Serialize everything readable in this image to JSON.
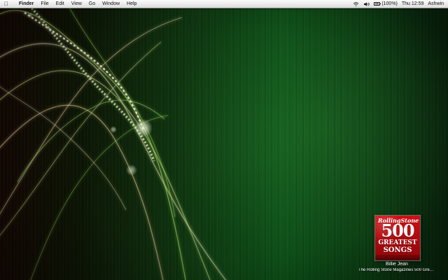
{
  "menubar": {
    "app_name": "Finder",
    "menus": [
      "File",
      "Edit",
      "View",
      "Go",
      "Window",
      "Help"
    ],
    "status": {
      "battery_text": "(100%)",
      "time": "Thu 12:59",
      "user": "Ashwin"
    },
    "icons": {
      "apple": "apple-icon",
      "wifi": "wifi-icon",
      "volume": "volume-icon",
      "battery": "battery-icon"
    }
  },
  "desktop": {
    "wallpaper": {
      "dominant_colors": [
        "#0d5318",
        "#103a11",
        "#150803",
        "#f1f4b8",
        "#b9ff66"
      ]
    },
    "now_playing": {
      "album_art": {
        "logo": "RollingStone",
        "number": "500",
        "title_line_1": "GREATEST",
        "title_line_2": "SONGS"
      },
      "song": "Billie Jean",
      "album": "The Rolling Stone Magazines 500 Greatest ..."
    }
  }
}
